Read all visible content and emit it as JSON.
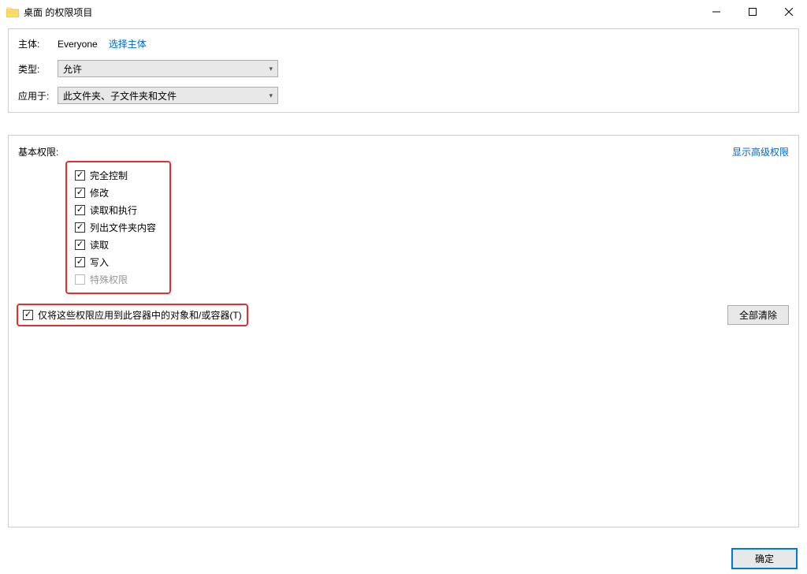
{
  "window": {
    "title": "桌面 的权限项目"
  },
  "principal": {
    "label": "主体:",
    "value": "Everyone",
    "select_link": "选择主体"
  },
  "type": {
    "label": "类型:",
    "value": "允许"
  },
  "applies_to": {
    "label": "应用于:",
    "value": "此文件夹、子文件夹和文件"
  },
  "permissions": {
    "label": "基本权限:",
    "advanced_link": "显示高级权限",
    "items": [
      {
        "label": "完全控制",
        "checked": true,
        "disabled": false
      },
      {
        "label": "修改",
        "checked": true,
        "disabled": false
      },
      {
        "label": "读取和执行",
        "checked": true,
        "disabled": false
      },
      {
        "label": "列出文件夹内容",
        "checked": true,
        "disabled": false
      },
      {
        "label": "读取",
        "checked": true,
        "disabled": false
      },
      {
        "label": "写入",
        "checked": true,
        "disabled": false
      },
      {
        "label": "特殊权限",
        "checked": false,
        "disabled": true
      }
    ]
  },
  "apply_only": {
    "label": "仅将这些权限应用到此容器中的对象和/或容器(T)",
    "checked": true
  },
  "buttons": {
    "clear_all": "全部清除",
    "ok": "确定"
  }
}
